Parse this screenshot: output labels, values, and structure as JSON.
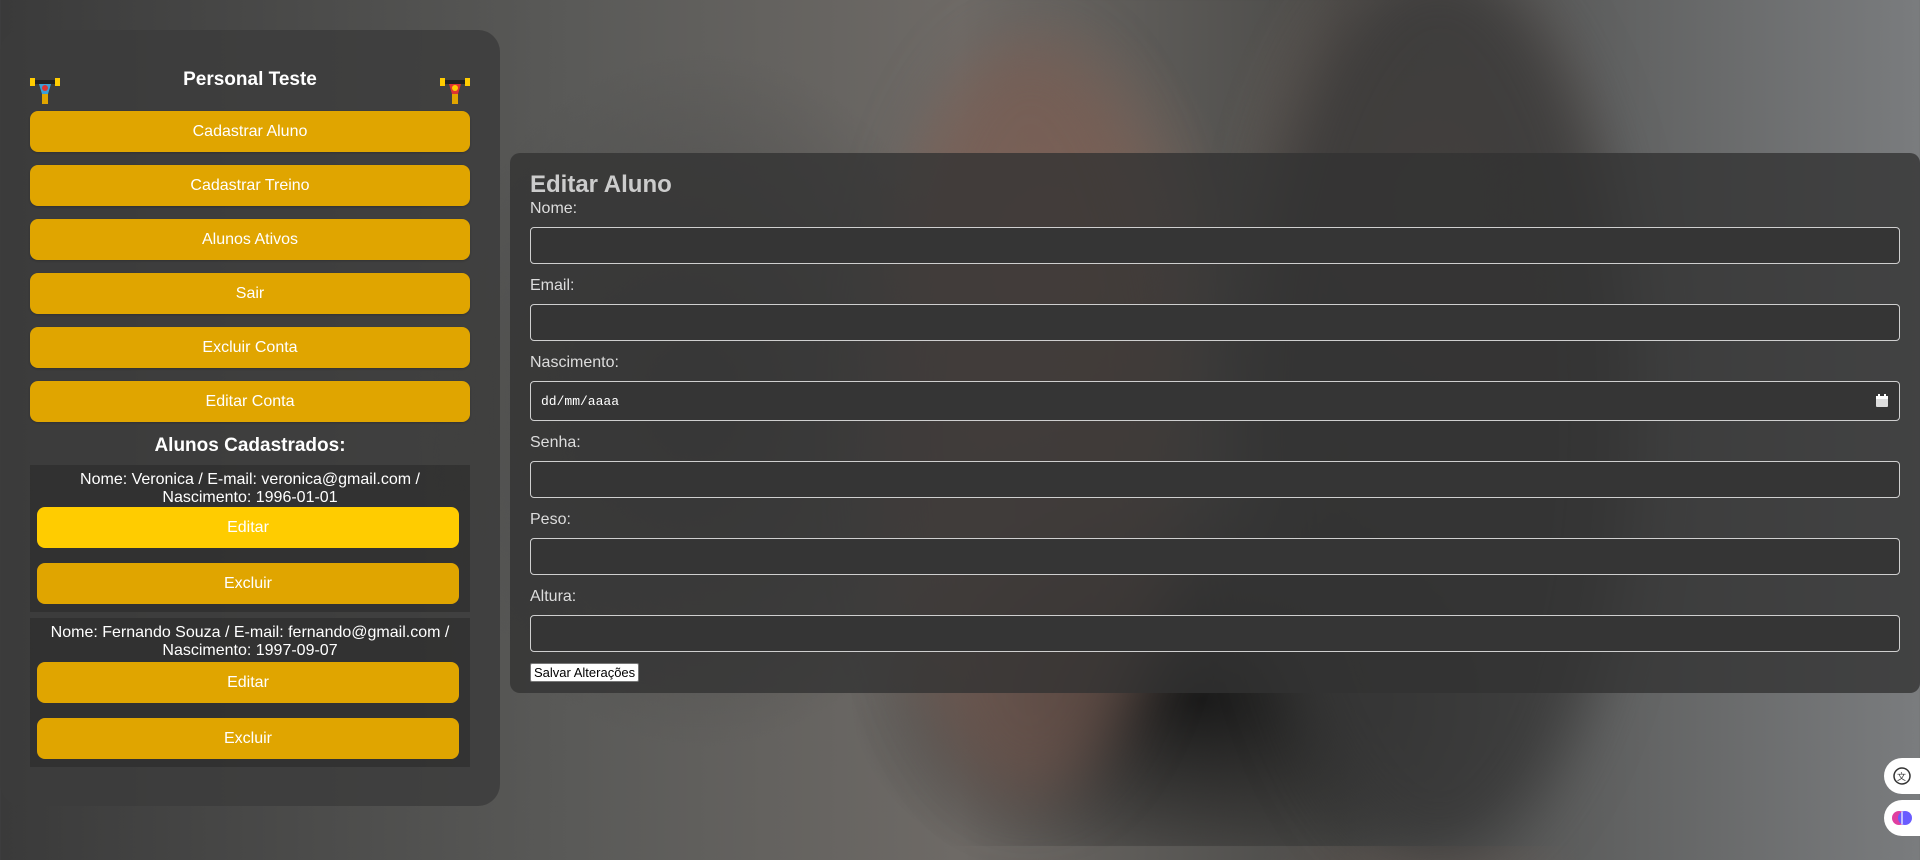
{
  "sidebar": {
    "title": "Personal Teste",
    "menu": [
      {
        "label": "Cadastrar Aluno",
        "name": "cadastrar-aluno-button"
      },
      {
        "label": "Cadastrar Treino",
        "name": "cadastrar-treino-button"
      },
      {
        "label": "Alunos Ativos",
        "name": "alunos-ativos-button"
      },
      {
        "label": "Sair",
        "name": "sair-button"
      },
      {
        "label": "Excluir Conta",
        "name": "excluir-conta-button"
      },
      {
        "label": "Editar Conta",
        "name": "editar-conta-button"
      }
    ],
    "students_title": "Alunos Cadastrados:",
    "students": [
      {
        "info": "Nome: Veronica / E-mail: veronica@gmail.com / Nascimento: 1996-01-01",
        "edit_label": "Editar",
        "delete_label": "Excluir"
      },
      {
        "info": "Nome: Fernando Souza / E-mail: fernando@gmail.com / Nascimento: 1997-09-07",
        "edit_label": "Editar",
        "delete_label": "Excluir"
      }
    ]
  },
  "edit_form": {
    "title": "Editar Aluno",
    "fields": {
      "nome": {
        "label": "Nome:",
        "value": ""
      },
      "email": {
        "label": "Email:",
        "value": ""
      },
      "nascimento": {
        "label": "Nascimento:",
        "placeholder": "dd/mm/aaaa"
      },
      "senha": {
        "label": "Senha:",
        "value": ""
      },
      "peso": {
        "label": "Peso:",
        "value": ""
      },
      "altura": {
        "label": "Altura:",
        "value": ""
      }
    },
    "save_label": "Salvar Alterações"
  },
  "icons": {
    "logo": "dumbbell-man-icon",
    "calendar": "calendar-icon",
    "translate": "translate-icon",
    "extension": "brain-icon"
  },
  "colors": {
    "accent": "#e0a500",
    "accent_highlight": "#ffcc00"
  }
}
